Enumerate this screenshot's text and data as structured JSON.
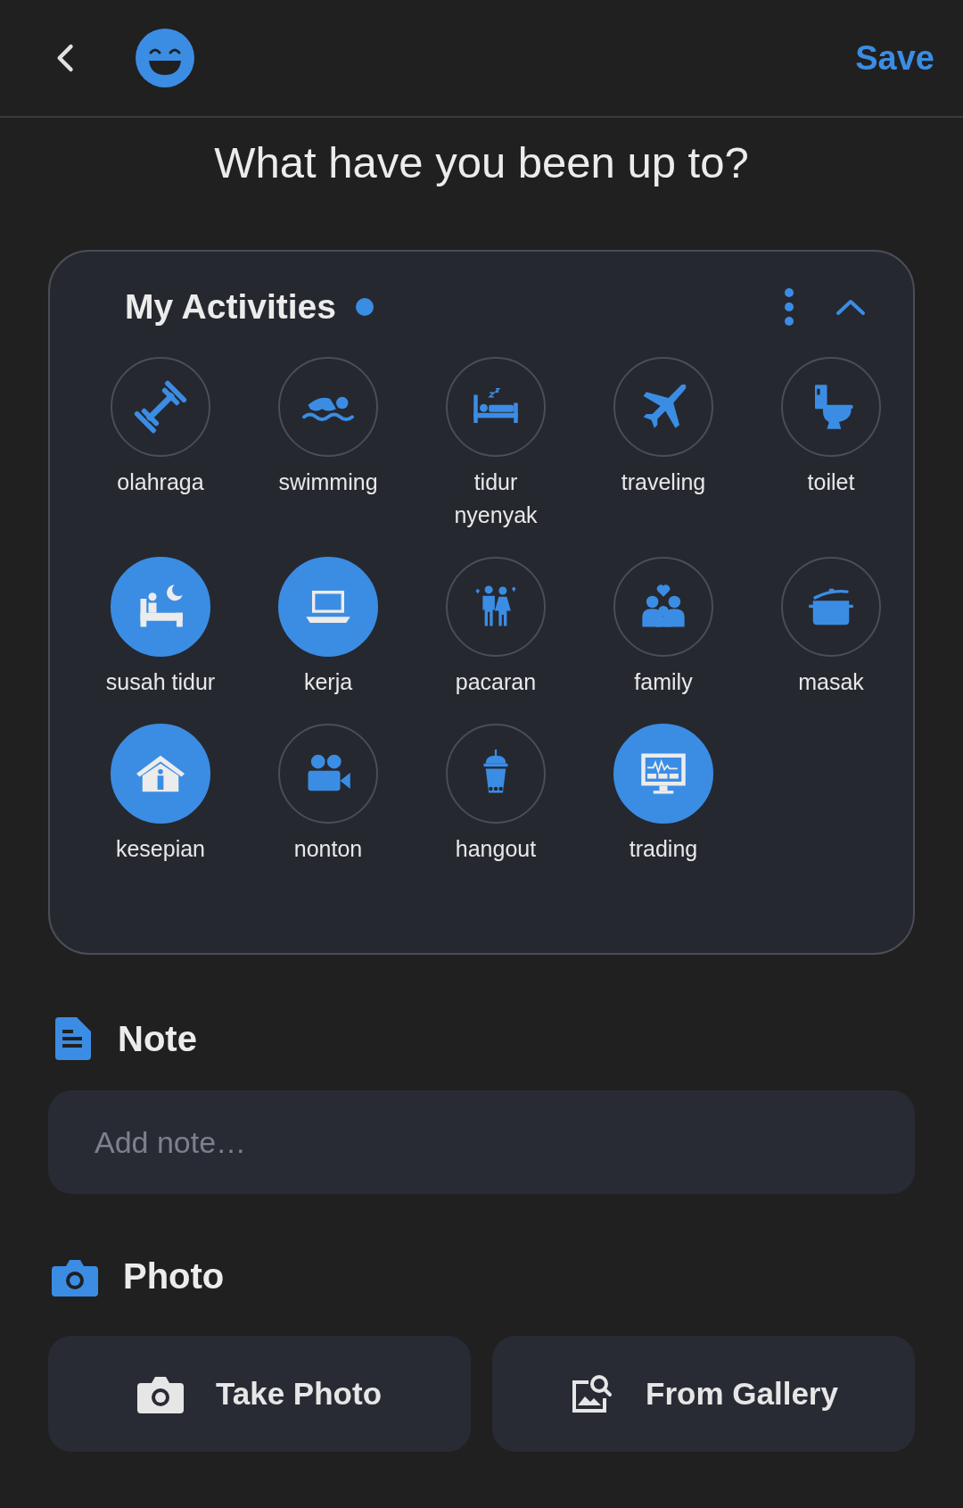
{
  "header": {
    "save": "Save"
  },
  "title": "What have you been up to?",
  "activities": {
    "title": "My Activities",
    "items": [
      {
        "label": "olahraga",
        "selected": false
      },
      {
        "label": "swimming",
        "selected": false
      },
      {
        "label": "tidur nyenyak",
        "selected": false
      },
      {
        "label": "traveling",
        "selected": false
      },
      {
        "label": "toilet",
        "selected": false
      },
      {
        "label": "susah tidur",
        "selected": true
      },
      {
        "label": "kerja",
        "selected": true
      },
      {
        "label": "pacaran",
        "selected": false
      },
      {
        "label": "family",
        "selected": false
      },
      {
        "label": "masak",
        "selected": false
      },
      {
        "label": "kesepian",
        "selected": true
      },
      {
        "label": "nonton",
        "selected": false
      },
      {
        "label": "hangout",
        "selected": false
      },
      {
        "label": "trading",
        "selected": true
      }
    ]
  },
  "note": {
    "heading": "Note",
    "placeholder": "Add note…"
  },
  "photo": {
    "heading": "Photo",
    "buttons": [
      "Take Photo",
      "From Gallery"
    ]
  }
}
